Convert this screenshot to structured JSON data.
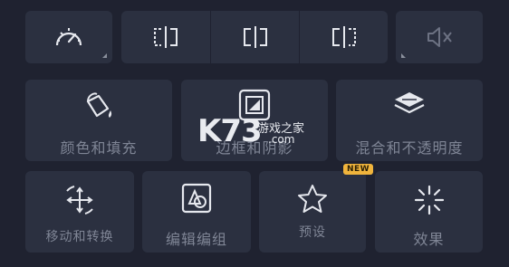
{
  "top_row": {
    "speed_icon": "speedometer-icon",
    "split_icons": [
      "split-left-icon",
      "split-center-icon",
      "split-right-icon"
    ],
    "mute_icon": "mute-icon"
  },
  "tools": [
    {
      "label": "颜色和填充",
      "icon": "paint-bucket-icon"
    },
    {
      "label": "边框和阴影",
      "icon": "border-shadow-icon"
    },
    {
      "label": "混合和不透明度",
      "icon": "layers-blend-icon"
    },
    {
      "label": "移动和转换",
      "icon": "move-transform-icon"
    },
    {
      "label": "编辑编组",
      "icon": "edit-group-icon"
    },
    {
      "label": "预设",
      "icon": "star-icon",
      "badge": "NEW"
    },
    {
      "label": "效果",
      "icon": "sparkle-icon"
    }
  ],
  "watermark": {
    "big": "K73",
    "cn": "游戏之家",
    "com": ".com"
  },
  "colors": {
    "background": "#1f2230",
    "tile": "#2b3040",
    "badge": "#f0b43c",
    "text": "#7f8595"
  }
}
